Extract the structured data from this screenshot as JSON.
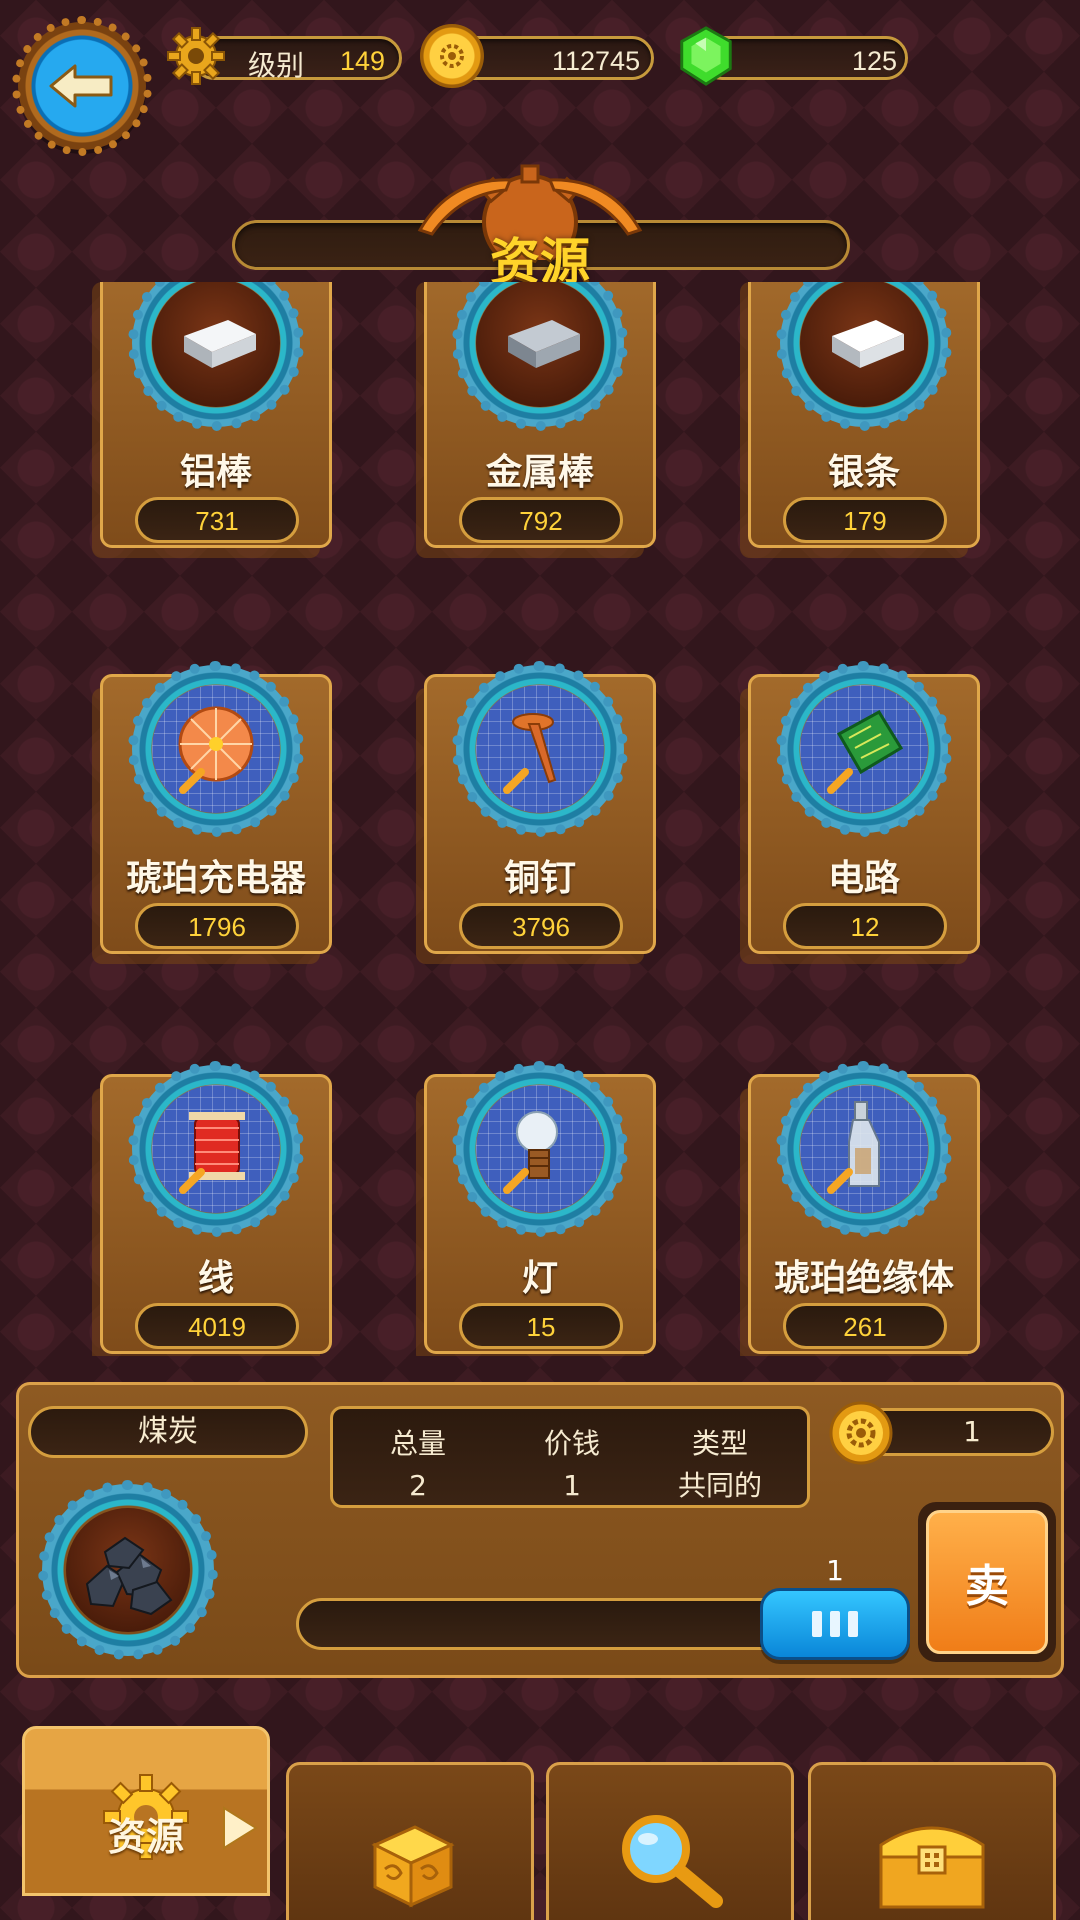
{
  "header": {
    "level_label": "级别",
    "level_value": "149",
    "coins": "112745",
    "gems": "125"
  },
  "title": "资源",
  "resources": [
    {
      "name": "铝棒",
      "count": "731",
      "icon": "aluminum-bar-icon",
      "type": "ingot"
    },
    {
      "name": "金属棒",
      "count": "792",
      "icon": "metal-bar-icon",
      "type": "ingot"
    },
    {
      "name": "银条",
      "count": "179",
      "icon": "silver-bar-icon",
      "type": "ingot"
    },
    {
      "name": "琥珀充电器",
      "count": "1796",
      "icon": "amber-charger-icon",
      "type": "blueprint"
    },
    {
      "name": "铜钉",
      "count": "3796",
      "icon": "copper-nail-icon",
      "type": "blueprint"
    },
    {
      "name": "电路",
      "count": "12",
      "icon": "circuit-board-icon",
      "type": "blueprint"
    },
    {
      "name": "线",
      "count": "4019",
      "icon": "thread-spool-icon",
      "type": "blueprint"
    },
    {
      "name": "灯",
      "count": "15",
      "icon": "light-bulb-icon",
      "type": "blueprint"
    },
    {
      "name": "琥珀绝缘体",
      "count": "261",
      "icon": "bottle-insulator-icon",
      "type": "blueprint"
    }
  ],
  "detail": {
    "name": "煤炭",
    "total_label": "总量",
    "total_value": "2",
    "price_label": "价钱",
    "price_value": "1",
    "type_label": "类型",
    "type_value": "共同的",
    "sell_price": "1",
    "quantity": "1",
    "quantity_fraction": 1.0,
    "sell_label": "卖"
  },
  "tabs": [
    {
      "label": "资源",
      "icon": "gear-icon",
      "active": true
    },
    {
      "label": "",
      "icon": "dice-icon",
      "active": false
    },
    {
      "label": "",
      "icon": "magnifier-icon",
      "active": false
    },
    {
      "label": "",
      "icon": "treasure-chest-icon",
      "active": false
    }
  ],
  "colors": {
    "accent_gold": "#ffd42a",
    "panel_brown": "#8e5a22",
    "border_gold": "#dca14a",
    "thumb_blue": "#1aa6ee",
    "sell_orange": "#f58a20"
  }
}
